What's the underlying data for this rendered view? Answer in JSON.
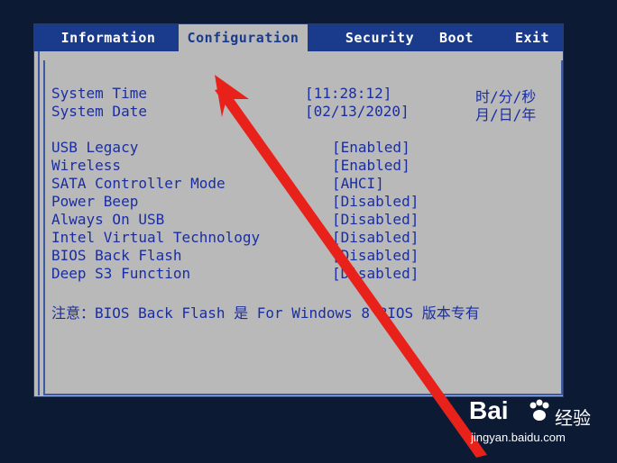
{
  "tabs": [
    "Information",
    "Configuration",
    "Security",
    "Boot",
    "Exit"
  ],
  "active_tab": "Configuration",
  "time": {
    "label": "System Time",
    "value": "[11:28:12]",
    "unit": "时/分/秒"
  },
  "date": {
    "label": "System Date",
    "value": "[02/13/2020]",
    "unit": "月/日/年"
  },
  "settings": [
    {
      "label": "USB Legacy",
      "value": "[Enabled]"
    },
    {
      "label": "Wireless",
      "value": "[Enabled]"
    },
    {
      "label": "SATA Controller Mode",
      "value": "[AHCI]"
    },
    {
      "label": "Power Beep",
      "value": "[Disabled]"
    },
    {
      "label": "Always On USB",
      "value": "[Disabled]"
    },
    {
      "label": "Intel Virtual Technology",
      "value": "[Disabled]"
    },
    {
      "label": "BIOS Back Flash",
      "value": "[Disabled]"
    },
    {
      "label": "Deep S3 Function",
      "value": "[Disabled]"
    }
  ],
  "note": "注意：BIOS Back Flash 是 For Windows 8 BIOS 版本专有",
  "watermark": {
    "brand": "Bai",
    "brand2": "经验",
    "sub": "jingyan.baidu.com"
  },
  "colors": {
    "tab_bg": "#1a3a8c",
    "panel_bg": "#b9b9b9",
    "text": "#1b2ea0",
    "arrow": "#e8221b"
  }
}
